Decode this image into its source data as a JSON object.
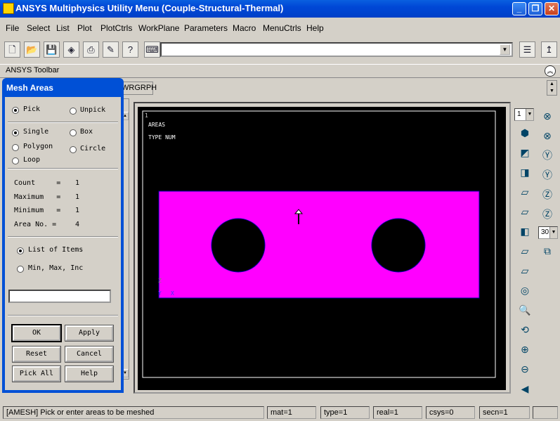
{
  "window": {
    "title": "ANSYS Multiphysics Utility Menu (Couple-Structural-Thermal)"
  },
  "window_controls": {
    "minimize": "_",
    "restore": "❐",
    "close": "✕"
  },
  "menu": [
    "File",
    "Select",
    "List",
    "Plot",
    "PlotCtrls",
    "WorkPlane",
    "Parameters",
    "Macro",
    "MenuCtrls",
    "Help"
  ],
  "toolbar": {
    "command_input_value": "",
    "icons": [
      "new-file-icon",
      "open-folder-icon",
      "save-icon",
      "3d-box-icon",
      "print-icon",
      "report-icon",
      "help-icon",
      "keyboard-icon"
    ],
    "right_icons": [
      "toolbar-toggle-icon",
      "raise-hidden-icon"
    ]
  },
  "ansys_toolbar": {
    "label": "ANSYS Toolbar",
    "button": "WRGRPH"
  },
  "graphics": {
    "window_number": "1",
    "label_line1": "AREAS",
    "label_line2": "TYPE NUM",
    "axis_z": "Z",
    "axis_y": "Y",
    "axis_x": "X",
    "area_color": "#ff00ff",
    "background_color": "#000000"
  },
  "right_panel": {
    "window_select": "1",
    "zoom_select": "30",
    "icons": [
      "isometric-view-icon",
      "front-view-icon",
      "top-view-icon",
      "back-view-icon",
      "bottom-view-icon",
      "right-view-icon",
      "left-view-icon",
      "oblique-view-icon",
      "zoom-icon",
      "zoom-box-icon",
      "pan-icon",
      "zoom-in-icon",
      "zoom-out-icon",
      "dynamic-mode-icon"
    ],
    "rotate_icons": [
      "rotate-x-pos-icon",
      "rotate-x-neg-icon",
      "rotate-y-pos-icon",
      "rotate-y-neg-icon",
      "rotate-z-pos-icon",
      "rotate-z-neg-icon",
      "reset-view-icon"
    ]
  },
  "dialog": {
    "title": "Mesh Areas",
    "pick": "Pick",
    "unpick": "Unpick",
    "single": "Single",
    "box": "Box",
    "polygon": "Polygon",
    "circle": "Circle",
    "loop": "Loop",
    "count_label": "Count     =",
    "count_value": "1",
    "maximum_label": "Maximum   =",
    "maximum_value": "1",
    "minimum_label": "Minimum   =",
    "minimum_value": "1",
    "area_label": "Area No. =",
    "area_value": "4",
    "list_of_items": "List of Items",
    "min_max_inc": "Min, Max, Inc",
    "input_value": "",
    "buttons": {
      "ok": "OK",
      "apply": "Apply",
      "reset": "Reset",
      "cancel": "Cancel",
      "pick_all": "Pick All",
      "help": "Help"
    }
  },
  "status": {
    "prompt": "[AMESH]  Pick or enter areas to be meshed",
    "mat": "mat=1",
    "type": "type=1",
    "real": "real=1",
    "csys": "csys=0",
    "secn": "secn=1"
  }
}
